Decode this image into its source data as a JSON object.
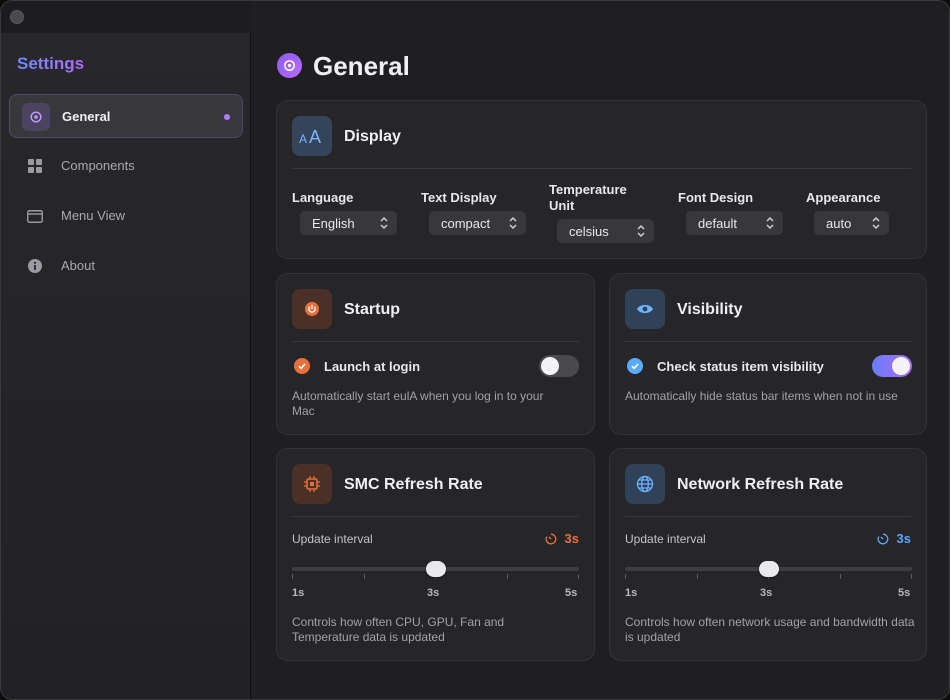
{
  "sidebar": {
    "title": "Settings",
    "items": [
      {
        "label": "General",
        "icon": "gear-icon",
        "active": true
      },
      {
        "label": "Components",
        "icon": "grid-icon"
      },
      {
        "label": "Menu View",
        "icon": "window-icon"
      },
      {
        "label": "About",
        "icon": "info-icon"
      }
    ]
  },
  "main": {
    "title": "General",
    "display": {
      "title": "Display",
      "icon": "text-size-icon",
      "fields": [
        {
          "label": "Language",
          "value": "English"
        },
        {
          "label": "Text Display",
          "value": "compact"
        },
        {
          "label": "Temperature Unit",
          "value": "celsius"
        },
        {
          "label": "Font Design",
          "value": "default"
        },
        {
          "label": "Appearance",
          "value": "auto"
        }
      ]
    },
    "startup": {
      "title": "Startup",
      "icon": "power-icon",
      "option_label": "Launch at login",
      "enabled": false,
      "description": "Automatically start eulA when you log in to your Mac"
    },
    "visibility": {
      "title": "Visibility",
      "icon": "eye-icon",
      "option_label": "Check status item visibility",
      "enabled": true,
      "description": "Automatically hide status bar items when not in use"
    },
    "smc": {
      "title": "SMC Refresh Rate",
      "icon": "chip-icon",
      "interval_label": "Update interval",
      "value": "3s",
      "min_label": "1s",
      "mid_label": "3s",
      "max_label": "5s",
      "slider_fraction": 0.5,
      "description": "Controls how often CPU, GPU, Fan and Temperature data is updated"
    },
    "network": {
      "title": "Network Refresh Rate",
      "icon": "globe-icon",
      "interval_label": "Update interval",
      "value": "3s",
      "min_label": "1s",
      "mid_label": "3s",
      "max_label": "5s",
      "slider_fraction": 0.5,
      "description": "Controls how often network usage and bandwidth data is updated"
    }
  },
  "colors": {
    "accent_purple": "#8b5cf6",
    "startup_orange": "#e8703a",
    "visibility_blue": "#5aa9ff",
    "smc_orange": "#e8703a",
    "network_blue": "#5aa9ff"
  }
}
